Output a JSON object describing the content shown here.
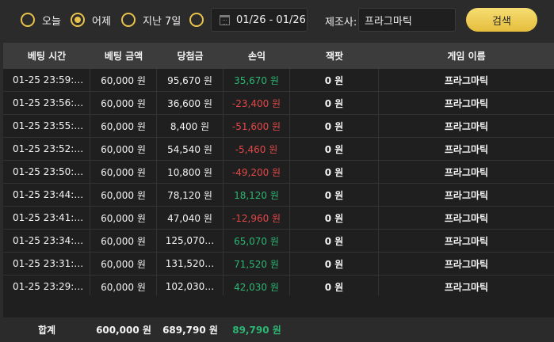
{
  "filters": {
    "options": [
      {
        "label": "오늘",
        "selected": false
      },
      {
        "label": "어제",
        "selected": true
      },
      {
        "label": "지난 7일",
        "selected": false
      },
      {
        "label": "",
        "selected": false
      }
    ],
    "date_range": "01/26 - 01/26",
    "maker_label": "제조사:",
    "maker_value": "프라그마틱",
    "search_label": "검색"
  },
  "table": {
    "headers": [
      "베팅 시간",
      "베팅 금액",
      "당첨금",
      "손익",
      "잭팟",
      "게임 이름"
    ],
    "rows": [
      {
        "time": "01-25 23:59:…",
        "bet": "60,000 원",
        "win": "95,670 원",
        "profit": "35,670 원",
        "profit_sign": "pos",
        "jackpot": "0 원",
        "game": "프라그마틱"
      },
      {
        "time": "01-25 23:56:…",
        "bet": "60,000 원",
        "win": "36,600 원",
        "profit": "-23,400 원",
        "profit_sign": "neg",
        "jackpot": "0 원",
        "game": "프라그마틱"
      },
      {
        "time": "01-25 23:55:…",
        "bet": "60,000 원",
        "win": "8,400 원",
        "profit": "-51,600 원",
        "profit_sign": "neg",
        "jackpot": "0 원",
        "game": "프라그마틱"
      },
      {
        "time": "01-25 23:52:…",
        "bet": "60,000 원",
        "win": "54,540 원",
        "profit": "-5,460 원",
        "profit_sign": "neg",
        "jackpot": "0 원",
        "game": "프라그마틱"
      },
      {
        "time": "01-25 23:50:…",
        "bet": "60,000 원",
        "win": "10,800 원",
        "profit": "-49,200 원",
        "profit_sign": "neg",
        "jackpot": "0 원",
        "game": "프라그마틱"
      },
      {
        "time": "01-25 23:44:…",
        "bet": "60,000 원",
        "win": "78,120 원",
        "profit": "18,120 원",
        "profit_sign": "pos",
        "jackpot": "0 원",
        "game": "프라그마틱"
      },
      {
        "time": "01-25 23:41:…",
        "bet": "60,000 원",
        "win": "47,040 원",
        "profit": "-12,960 원",
        "profit_sign": "neg",
        "jackpot": "0 원",
        "game": "프라그마틱"
      },
      {
        "time": "01-25 23:34:…",
        "bet": "60,000 원",
        "win": "125,070…",
        "profit": "65,070 원",
        "profit_sign": "pos",
        "jackpot": "0 원",
        "game": "프라그마틱"
      },
      {
        "time": "01-25 23:31:…",
        "bet": "60,000 원",
        "win": "131,520…",
        "profit": "71,520 원",
        "profit_sign": "pos",
        "jackpot": "0 원",
        "game": "프라그마틱"
      },
      {
        "time": "01-25 23:29:…",
        "bet": "60,000 원",
        "win": "102,030…",
        "profit": "42,030 원",
        "profit_sign": "pos",
        "jackpot": "0 원",
        "game": "프라그마틱"
      }
    ],
    "totals": {
      "label": "합계",
      "bet": "600,000 원",
      "win": "689,790 원",
      "profit": "89,790 원"
    }
  },
  "colors": {
    "accent": "#e8c24a",
    "positive": "#2bb673",
    "negative": "#e34848"
  }
}
